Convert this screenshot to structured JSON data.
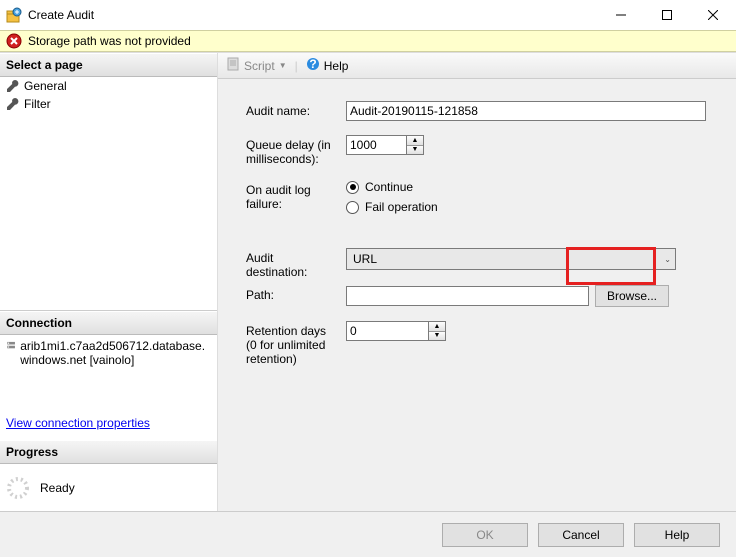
{
  "window": {
    "title": "Create Audit"
  },
  "error": {
    "message": "Storage path was not provided"
  },
  "leftPanel": {
    "selectPageHeader": "Select a page",
    "pages": {
      "general": "General",
      "filter": "Filter"
    },
    "connectionHeader": "Connection",
    "connectionServer": "arib1mi1.c7aa2d506712.database.windows.net [vainolo]",
    "connectionLink": "View connection properties",
    "progressHeader": "Progress",
    "progressStatus": "Ready"
  },
  "toolbar": {
    "script": "Script",
    "help": "Help"
  },
  "form": {
    "auditNameLabel": "Audit name:",
    "auditNameValue": "Audit-20190115-121858",
    "queueDelayLabel": "Queue delay (in milliseconds):",
    "queueDelayValue": "1000",
    "onFailureLabel": "On audit log failure:",
    "radioContinue": "Continue",
    "radioFailOp": "Fail operation",
    "radioSelected": "continue",
    "destinationLabel": "Audit destination:",
    "destinationValue": "URL",
    "pathLabel": "Path:",
    "pathValue": "",
    "browseLabel": "Browse...",
    "retentionLabel": "Retention days (0 for unlimited retention)",
    "retentionValue": "0"
  },
  "footer": {
    "ok": "OK",
    "cancel": "Cancel",
    "help": "Help"
  }
}
